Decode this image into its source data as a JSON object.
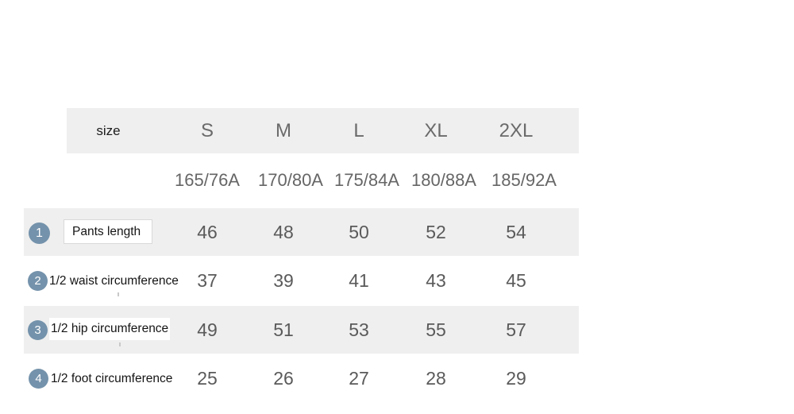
{
  "table": {
    "corner_label": "size",
    "size_columns": [
      "S",
      "M",
      "L",
      "XL",
      "2XL"
    ],
    "spec_row": [
      "165/76A",
      "170/80A",
      "175/84A",
      "180/88A",
      "185/92A"
    ],
    "rows": [
      {
        "badge": "1",
        "label": "Pants length",
        "values": [
          "46",
          "48",
          "50",
          "52",
          "54"
        ]
      },
      {
        "badge": "2",
        "label": "1/2 waist circumference",
        "values": [
          "37",
          "39",
          "41",
          "43",
          "45"
        ]
      },
      {
        "badge": "3",
        "label": "1/2 hip circumference",
        "values": [
          "49",
          "51",
          "53",
          "55",
          "57"
        ]
      },
      {
        "badge": "4",
        "label": "1/2 foot circumference",
        "values": [
          "25",
          "26",
          "27",
          "28",
          "29"
        ]
      }
    ]
  },
  "colors": {
    "band": "#efefef",
    "badge": "#7492ab",
    "value_text": "#5a5a5a",
    "label_text": "#141414",
    "page_background": "#ffffff"
  }
}
